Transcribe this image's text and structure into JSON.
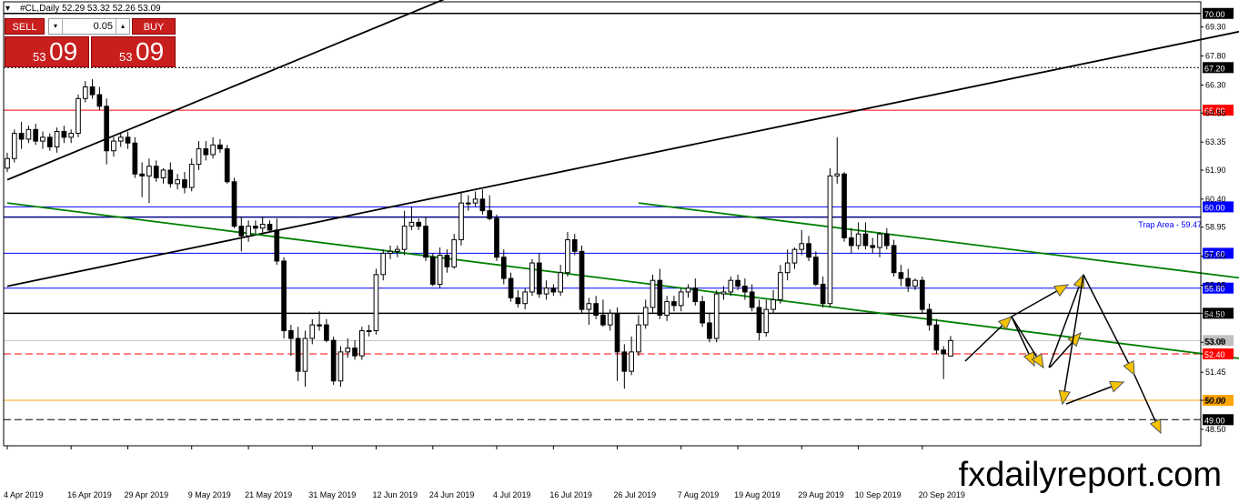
{
  "header": {
    "symbol_info": "#CL,Daily  52.29 53.32 52.26 53.09"
  },
  "trade_panel": {
    "sell_label": "SELL",
    "buy_label": "BUY",
    "lot": "0.05",
    "down_arrow": "▾",
    "up_arrow": "▴",
    "sell_price_small": "53",
    "sell_price_big": "09",
    "buy_price_small": "53",
    "buy_price_big": "09",
    "color": "#c81e1e"
  },
  "watermark": "fxdailyreport.com",
  "chart_data": {
    "type": "candlestick",
    "symbol": "#CL",
    "timeframe": "Daily",
    "ohlc_last": {
      "open": 52.29,
      "high": 53.32,
      "low": 52.26,
      "close": 53.09
    },
    "ylim": [
      47.65,
      70.6
    ],
    "y_ticks": [
      "69.30",
      "67.80",
      "66.30",
      "64.85",
      "63.35",
      "61.90",
      "60.40",
      "58.95",
      "57.45",
      "55.95",
      "54.50",
      "53.00",
      "51.45",
      "50.00",
      "48.50"
    ],
    "x_tick_labels": [
      "4 Apr 2019",
      "16 Apr 2019",
      "29 Apr 2019",
      "9 May 2019",
      "21 May 2019",
      "31 May 2019",
      "12 Jun 2019",
      "24 Jun 2019",
      "4 Jul 2019",
      "16 Jul 2019",
      "26 Jul 2019",
      "7 Aug 2019",
      "19 Aug 2019",
      "29 Aug 2019",
      "10 Sep 2019",
      "20 Sep 2019"
    ],
    "levels": [
      {
        "value": 70.0,
        "label": "70.00",
        "color": "#000000",
        "style": "solid",
        "width": 1.5
      },
      {
        "value": 67.2,
        "label": "67.20",
        "color": "#000000",
        "style": "dotted",
        "width": 1
      },
      {
        "value": 65.0,
        "label": "65.00",
        "color": "#ff0000",
        "style": "solid",
        "width": 1
      },
      {
        "value": 60.0,
        "label": "60.00",
        "color": "#0000ff",
        "style": "solid",
        "width": 1
      },
      {
        "value": 59.47,
        "label": "",
        "color": "#00008b",
        "style": "solid",
        "width": 1.5
      },
      {
        "value": 57.6,
        "label": "57.60",
        "color": "#0000ff",
        "style": "solid",
        "width": 1
      },
      {
        "value": 55.8,
        "label": "55.80",
        "color": "#0000ff",
        "style": "solid",
        "width": 1
      },
      {
        "value": 54.5,
        "label": "54.50",
        "color": "#000000",
        "style": "solid",
        "width": 1.5
      },
      {
        "value": 53.09,
        "label": "53.09",
        "color": "#c0c0c0",
        "style": "solid",
        "width": 1
      },
      {
        "value": 52.4,
        "label": "52.40",
        "color": "#ff0000",
        "style": "dashed",
        "width": 1
      },
      {
        "value": 50.0,
        "label": "50.00",
        "color": "#ffa500",
        "style": "solid",
        "width": 1
      },
      {
        "value": 49.0,
        "label": "49.00",
        "color": "#000000",
        "style": "dashed",
        "width": 1
      }
    ],
    "annotation": {
      "text": "Trap Area - 59.47",
      "color": "#0000ff",
      "value": 59.47
    },
    "trendlines": [
      {
        "color": "#000000",
        "points": [
          [
            0,
            61.4
          ],
          [
            66,
            71.4
          ]
        ]
      },
      {
        "color": "#000000",
        "points": [
          [
            0,
            55.9
          ],
          [
            194,
            70.6
          ]
        ]
      },
      {
        "color": "#008000",
        "points": [
          [
            0,
            60.2
          ],
          [
            240,
            49.1
          ]
        ]
      },
      {
        "color": "#008000",
        "points": [
          [
            89,
            60.2
          ],
          [
            240,
            53.3
          ]
        ]
      }
    ],
    "candles": [
      [
        62.0,
        62.8,
        61.8,
        62.5
      ],
      [
        62.5,
        64.0,
        62.3,
        63.8
      ],
      [
        63.8,
        64.4,
        63.0,
        63.5
      ],
      [
        63.5,
        64.2,
        63.3,
        64.0
      ],
      [
        64.0,
        64.3,
        63.2,
        63.4
      ],
      [
        63.4,
        63.9,
        63.0,
        63.6
      ],
      [
        63.6,
        63.8,
        62.9,
        63.1
      ],
      [
        63.1,
        64.1,
        62.8,
        63.9
      ],
      [
        63.9,
        64.2,
        63.3,
        63.6
      ],
      [
        63.6,
        64.0,
        63.3,
        63.8
      ],
      [
        63.8,
        65.8,
        63.6,
        65.6
      ],
      [
        65.6,
        66.5,
        65.4,
        66.2
      ],
      [
        66.2,
        66.6,
        65.6,
        65.8
      ],
      [
        65.8,
        66.2,
        65.0,
        65.2
      ],
      [
        65.2,
        65.6,
        62.2,
        62.9
      ],
      [
        62.9,
        63.6,
        62.6,
        63.4
      ],
      [
        63.4,
        63.8,
        63.1,
        63.6
      ],
      [
        63.6,
        63.9,
        63.0,
        63.3
      ],
      [
        63.3,
        63.6,
        61.5,
        61.7
      ],
      [
        61.7,
        62.3,
        60.5,
        61.6
      ],
      [
        61.6,
        62.5,
        60.2,
        62.1
      ],
      [
        62.1,
        62.4,
        61.3,
        61.5
      ],
      [
        61.5,
        62.0,
        61.2,
        61.9
      ],
      [
        61.9,
        62.3,
        61.0,
        61.2
      ],
      [
        61.2,
        61.7,
        60.9,
        61.4
      ],
      [
        61.4,
        61.8,
        60.7,
        61.0
      ],
      [
        61.0,
        62.5,
        60.8,
        62.2
      ],
      [
        62.2,
        63.4,
        61.9,
        63.0
      ],
      [
        63.0,
        63.4,
        62.4,
        62.7
      ],
      [
        62.7,
        63.6,
        62.5,
        63.2
      ],
      [
        63.2,
        63.5,
        62.8,
        63.0
      ],
      [
        63.0,
        63.2,
        61.2,
        61.3
      ],
      [
        61.3,
        61.5,
        58.9,
        59.0
      ],
      [
        59.0,
        59.5,
        57.7,
        58.5
      ],
      [
        58.5,
        59.3,
        58.2,
        59.0
      ],
      [
        59.0,
        59.3,
        58.6,
        58.9
      ],
      [
        58.9,
        59.5,
        58.6,
        59.1
      ],
      [
        59.1,
        59.3,
        58.7,
        58.8
      ],
      [
        58.8,
        59.4,
        57.0,
        57.2
      ],
      [
        57.2,
        57.4,
        53.2,
        53.6
      ],
      [
        53.6,
        53.9,
        52.3,
        53.2
      ],
      [
        53.2,
        53.8,
        51.0,
        51.5
      ],
      [
        51.5,
        53.6,
        50.7,
        53.2
      ],
      [
        53.2,
        54.2,
        52.9,
        53.9
      ],
      [
        53.9,
        54.6,
        53.6,
        53.9
      ],
      [
        53.9,
        54.2,
        53.0,
        53.1
      ],
      [
        53.1,
        53.3,
        50.8,
        51.0
      ],
      [
        51.0,
        52.8,
        50.7,
        52.5
      ],
      [
        52.5,
        53.2,
        52.2,
        52.7
      ],
      [
        52.7,
        53.1,
        52.1,
        52.3
      ],
      [
        52.3,
        53.8,
        52.1,
        53.6
      ],
      [
        53.6,
        53.9,
        53.3,
        53.6
      ],
      [
        53.6,
        56.8,
        53.4,
        56.5
      ],
      [
        56.5,
        57.8,
        56.2,
        57.6
      ],
      [
        57.6,
        58.0,
        57.3,
        57.7
      ],
      [
        57.7,
        58.0,
        57.4,
        57.8
      ],
      [
        57.8,
        59.8,
        57.5,
        59.0
      ],
      [
        59.0,
        60.0,
        58.8,
        59.2
      ],
      [
        59.2,
        59.4,
        58.8,
        59.0
      ],
      [
        59.0,
        59.5,
        57.2,
        57.4
      ],
      [
        57.4,
        57.6,
        55.9,
        56.0
      ],
      [
        56.0,
        57.9,
        55.8,
        57.5
      ],
      [
        57.5,
        57.8,
        56.6,
        56.9
      ],
      [
        56.9,
        58.6,
        56.8,
        58.3
      ],
      [
        58.3,
        60.8,
        58.0,
        60.2
      ],
      [
        60.2,
        60.6,
        59.8,
        60.2
      ],
      [
        60.2,
        60.8,
        60.0,
        60.4
      ],
      [
        60.4,
        60.9,
        59.6,
        59.8
      ],
      [
        59.8,
        60.6,
        59.3,
        59.4
      ],
      [
        59.4,
        59.6,
        57.2,
        57.4
      ],
      [
        57.4,
        57.8,
        56.0,
        56.3
      ],
      [
        56.3,
        56.6,
        55.1,
        55.3
      ],
      [
        55.3,
        55.7,
        54.8,
        55.0
      ],
      [
        55.0,
        55.8,
        54.7,
        55.6
      ],
      [
        55.6,
        57.3,
        55.4,
        57.1
      ],
      [
        57.1,
        57.6,
        55.3,
        55.5
      ],
      [
        55.5,
        56.2,
        55.2,
        55.8
      ],
      [
        55.8,
        56.0,
        55.4,
        55.6
      ],
      [
        55.6,
        57.0,
        55.4,
        56.6
      ],
      [
        56.6,
        58.7,
        56.4,
        58.3
      ],
      [
        58.3,
        58.6,
        57.5,
        57.7
      ],
      [
        57.7,
        58.0,
        54.5,
        54.7
      ],
      [
        54.7,
        55.3,
        53.9,
        55.0
      ],
      [
        55.0,
        55.4,
        54.2,
        54.4
      ],
      [
        54.4,
        55.2,
        53.8,
        53.9
      ],
      [
        53.9,
        54.7,
        53.6,
        54.5
      ],
      [
        54.5,
        54.8,
        51.0,
        52.5
      ],
      [
        52.5,
        52.9,
        50.6,
        51.5
      ],
      [
        51.5,
        53.3,
        51.3,
        52.5
      ],
      [
        52.5,
        54.4,
        52.3,
        53.9
      ],
      [
        53.9,
        55.2,
        53.7,
        54.8
      ],
      [
        54.8,
        56.5,
        54.5,
        56.2
      ],
      [
        56.2,
        56.8,
        54.2,
        54.4
      ],
      [
        54.4,
        55.4,
        54.1,
        55.1
      ],
      [
        55.1,
        55.4,
        54.6,
        54.9
      ],
      [
        54.9,
        55.8,
        54.6,
        55.6
      ],
      [
        55.6,
        56.0,
        55.3,
        55.8
      ],
      [
        55.8,
        56.3,
        54.9,
        55.1
      ],
      [
        55.1,
        55.4,
        53.8,
        54.0
      ],
      [
        54.0,
        54.5,
        53.0,
        53.2
      ],
      [
        53.2,
        55.7,
        53.0,
        55.5
      ],
      [
        55.5,
        55.9,
        55.2,
        55.6
      ],
      [
        55.6,
        56.4,
        55.4,
        56.2
      ],
      [
        56.2,
        56.5,
        55.7,
        55.9
      ],
      [
        55.9,
        56.3,
        55.2,
        55.6
      ],
      [
        55.6,
        56.0,
        54.6,
        54.8
      ],
      [
        54.8,
        55.2,
        53.1,
        53.5
      ],
      [
        53.5,
        55.2,
        53.3,
        54.7
      ],
      [
        54.7,
        55.7,
        54.5,
        55.2
      ],
      [
        55.2,
        57.0,
        55.0,
        56.6
      ],
      [
        56.6,
        57.8,
        56.2,
        57.1
      ],
      [
        57.1,
        57.9,
        56.8,
        57.8
      ],
      [
        57.8,
        58.8,
        57.5,
        58.1
      ],
      [
        58.1,
        58.5,
        57.2,
        57.4
      ],
      [
        57.4,
        57.7,
        55.9,
        56.0
      ],
      [
        56.0,
        56.4,
        54.8,
        55.0
      ],
      [
        55.0,
        62.0,
        54.8,
        61.6
      ],
      [
        61.6,
        63.6,
        61.2,
        61.7
      ],
      [
        61.7,
        61.8,
        58.2,
        58.4
      ],
      [
        58.4,
        58.9,
        57.6,
        58.0
      ],
      [
        58.0,
        59.2,
        57.8,
        58.6
      ],
      [
        58.6,
        59.2,
        57.8,
        58.0
      ],
      [
        58.0,
        58.4,
        57.6,
        57.9
      ],
      [
        57.9,
        58.7,
        57.4,
        58.6
      ],
      [
        58.6,
        58.9,
        57.8,
        58.0
      ],
      [
        58.0,
        58.3,
        56.4,
        56.6
      ],
      [
        56.6,
        57.0,
        55.9,
        56.3
      ],
      [
        56.3,
        56.8,
        55.6,
        55.9
      ],
      [
        55.9,
        56.3,
        55.7,
        56.2
      ],
      [
        56.2,
        56.4,
        54.5,
        54.7
      ],
      [
        54.7,
        55.0,
        53.6,
        53.9
      ],
      [
        53.9,
        54.2,
        52.4,
        52.6
      ],
      [
        52.6,
        52.8,
        51.1,
        52.4
      ],
      [
        52.29,
        53.32,
        52.26,
        53.09
      ]
    ],
    "forecast_arrows": [
      [
        [
          1061,
          397
        ],
        [
          1112,
          348
        ]
      ],
      [
        [
          1112,
          348
        ],
        [
          1137,
          402
        ]
      ],
      [
        [
          1112,
          348
        ],
        [
          1174,
          313
        ]
      ],
      [
        [
          1112,
          348
        ],
        [
          1147,
          404
        ]
      ],
      [
        [
          1154,
          404
        ],
        [
          1188,
          366
        ]
      ],
      [
        [
          1153,
          404
        ],
        [
          1191,
          302
        ]
      ],
      [
        [
          1191,
          302
        ],
        [
          1168,
          444
        ]
      ],
      [
        [
          1172,
          444
        ],
        [
          1235,
          420
        ]
      ],
      [
        [
          1191,
          302
        ],
        [
          1247,
          412
        ]
      ],
      [
        [
          1247,
          412
        ],
        [
          1276,
          476
        ]
      ]
    ],
    "grid": false,
    "colors": {
      "bull_body": "#ffffff",
      "bear_body": "#000000",
      "wick": "#000000",
      "axis_text": "#000000"
    }
  }
}
